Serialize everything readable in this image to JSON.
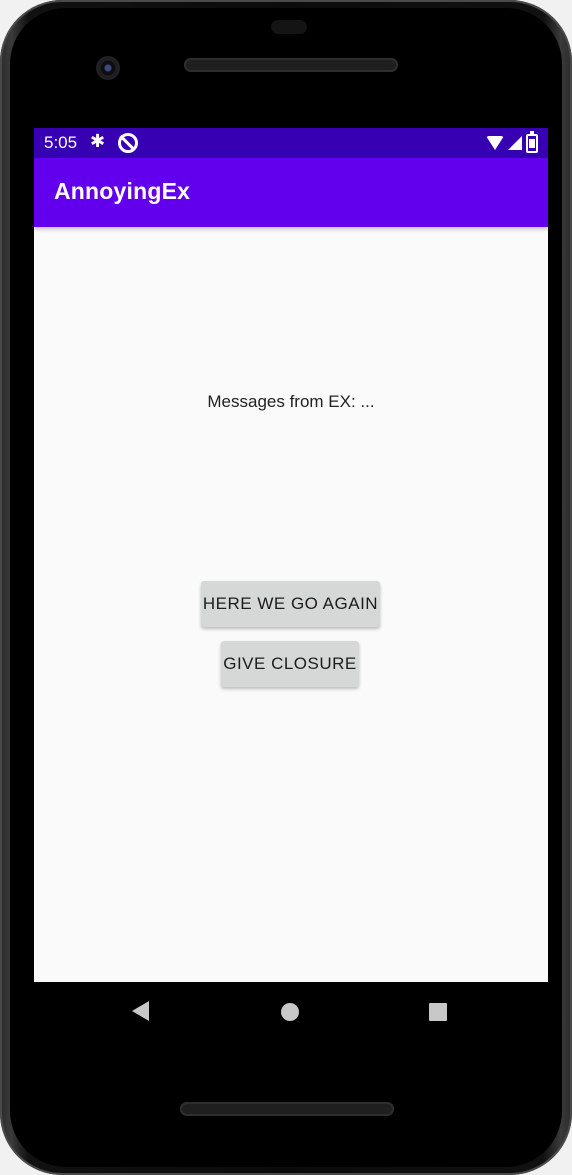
{
  "status_bar": {
    "time": "5:05",
    "icons": [
      "gear-icon",
      "do-not-disturb-icon",
      "wifi-icon",
      "signal-icon",
      "battery-icon"
    ]
  },
  "app_bar": {
    "title": "AnnoyingEx"
  },
  "main": {
    "message_text": "Messages from EX: ...",
    "buttons": [
      {
        "label": "HERE WE GO AGAIN"
      },
      {
        "label": "GIVE CLOSURE"
      }
    ]
  },
  "nav_bar": {
    "icons": [
      "back-icon",
      "home-icon",
      "recents-icon"
    ]
  },
  "colors": {
    "status_bar": "#3700b3",
    "app_bar": "#6200ee",
    "background": "#fafafa",
    "button": "#d6d7d7"
  }
}
